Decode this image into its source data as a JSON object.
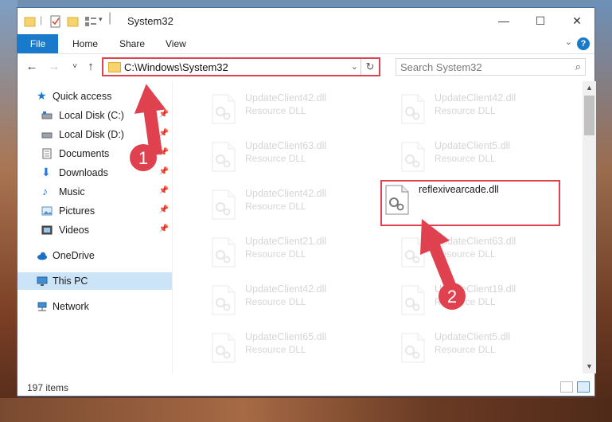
{
  "window": {
    "title": "System32",
    "controls": {
      "minimize": "—",
      "maximize": "☐",
      "close": "✕"
    }
  },
  "ribbon": {
    "tabs": [
      "File",
      "Home",
      "Share",
      "View"
    ],
    "help": "?"
  },
  "nav": {
    "back": "←",
    "forward": "→",
    "recent": "˅",
    "up": "↑",
    "address_path": "C:\\Windows\\System32",
    "search_placeholder": "Search System32"
  },
  "sidebar": {
    "items": [
      {
        "label": "Quick access",
        "icon": "star-icon"
      },
      {
        "label": "Local Disk (C:)",
        "icon": "drive-icon",
        "pinned": true
      },
      {
        "label": "Local Disk (D:)",
        "icon": "drive-icon",
        "pinned": true
      },
      {
        "label": "Documents",
        "icon": "documents-icon",
        "pinned": true
      },
      {
        "label": "Downloads",
        "icon": "downloads-icon",
        "pinned": true
      },
      {
        "label": "Music",
        "icon": "music-icon",
        "pinned": true
      },
      {
        "label": "Pictures",
        "icon": "pictures-icon",
        "pinned": true
      },
      {
        "label": "Videos",
        "icon": "videos-icon",
        "pinned": true
      },
      {
        "label": "OneDrive",
        "icon": "cloud-icon"
      },
      {
        "label": "This PC",
        "icon": "computer-icon",
        "selected": true
      },
      {
        "label": "Network",
        "icon": "network-icon"
      }
    ]
  },
  "files": [
    {
      "name": "UpdateClient42.dll",
      "type": "Resource DLL"
    },
    {
      "name": "UpdateClient42.dll",
      "type": "Resource DLL"
    },
    {
      "name": "UpdateClient63.dll",
      "type": "Resource DLL"
    },
    {
      "name": "UpdateClient5.dll",
      "type": "Resource DLL"
    },
    {
      "name": "UpdateClient42.dll",
      "type": "Resource DLL"
    },
    {
      "name": "reflexivearcade.dll",
      "type": ""
    },
    {
      "name": "UpdateClient21.dll",
      "type": "Resource DLL"
    },
    {
      "name": "UpdateClient63.dll",
      "type": "Resource DLL"
    },
    {
      "name": "UpdateClient42.dll",
      "type": "Resource DLL"
    },
    {
      "name": "UpdateClient19.dll",
      "type": "Resource DLL"
    },
    {
      "name": "UpdateClient65.dll",
      "type": "Resource DLL"
    },
    {
      "name": "UpdateClient5.dll",
      "type": "Resource DLL"
    }
  ],
  "status": {
    "item_count": "197 items"
  },
  "annotations": {
    "step1": "1",
    "step2": "2"
  },
  "colors": {
    "accent": "#1979ca",
    "highlight": "#e0414f",
    "selected_bg": "#cce4f7"
  }
}
